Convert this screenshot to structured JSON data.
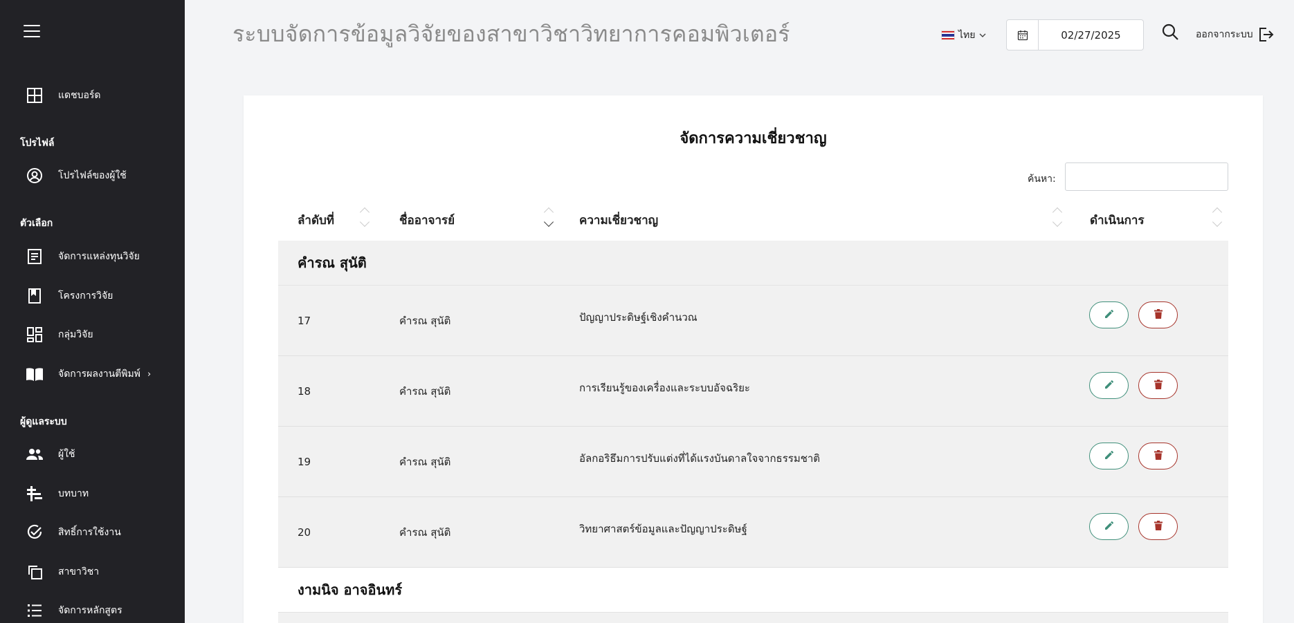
{
  "app": {
    "title": "ระบบจัดการข้อมูลวิจัยของสาขาวิชาวิทยาการคอมพิวเตอร์"
  },
  "header": {
    "language": "ไทย",
    "date": "02/27/2025",
    "logout_label": "ออกจากระบบ"
  },
  "sidebar": {
    "dashboard": "แดชบอร์ด",
    "section_profile": "โปรไฟล์",
    "profile": "โปรไฟล์ของผู้ใช้",
    "section_options": "ตัวเลือก",
    "funding": "จัดการแหล่งทุนวิจัย",
    "projects": "โครงการวิจัย",
    "groups": "กลุ่มวิจัย",
    "publications": "จัดการผลงานตีพิมพ์",
    "section_admin": "ผู้ดูแลระบบ",
    "users": "ผู้ใช้",
    "roles": "บทบาท",
    "permissions": "สิทธิ์การใช้งาน",
    "departments": "สาขาวิชา",
    "curriculum": "จัดการหลักสูตร"
  },
  "page": {
    "title": "จัดการความเชี่ยวชาญ",
    "search_label": "ค้นหา:",
    "search_value": ""
  },
  "table": {
    "columns": [
      "ลำดับที่",
      "ชื่ออาจารย์",
      "ความเชี่ยวชาญ",
      "ดำเนินการ"
    ],
    "group1": "คำรณ สุนัติ",
    "rows": [
      {
        "no": "17",
        "name": "คำรณ สุนัติ",
        "expertise": "ปัญญาประดิษฐ์เชิงคำนวณ"
      },
      {
        "no": "18",
        "name": "คำรณ สุนัติ",
        "expertise": "การเรียนรู้ของเครื่องและระบบอัจฉริยะ"
      },
      {
        "no": "19",
        "name": "คำรณ สุนัติ",
        "expertise": "อัลกอริธึมการปรับแต่งที่ได้แรงบันดาลใจจากธรรมชาติ"
      },
      {
        "no": "20",
        "name": "คำรณ สุนัติ",
        "expertise": "วิทยาศาสตร์ข้อมูลและปัญญาประดิษฐ์"
      }
    ],
    "group2": "งามนิจ อาจอินทร์"
  },
  "icons": {
    "menu": "hamburger-icon",
    "edit": "pencil-icon",
    "delete": "trash-icon"
  },
  "colors": {
    "sidebar_bg": "#222226",
    "edit_accent": "#3f8f7a",
    "delete_accent": "#a6332a"
  }
}
